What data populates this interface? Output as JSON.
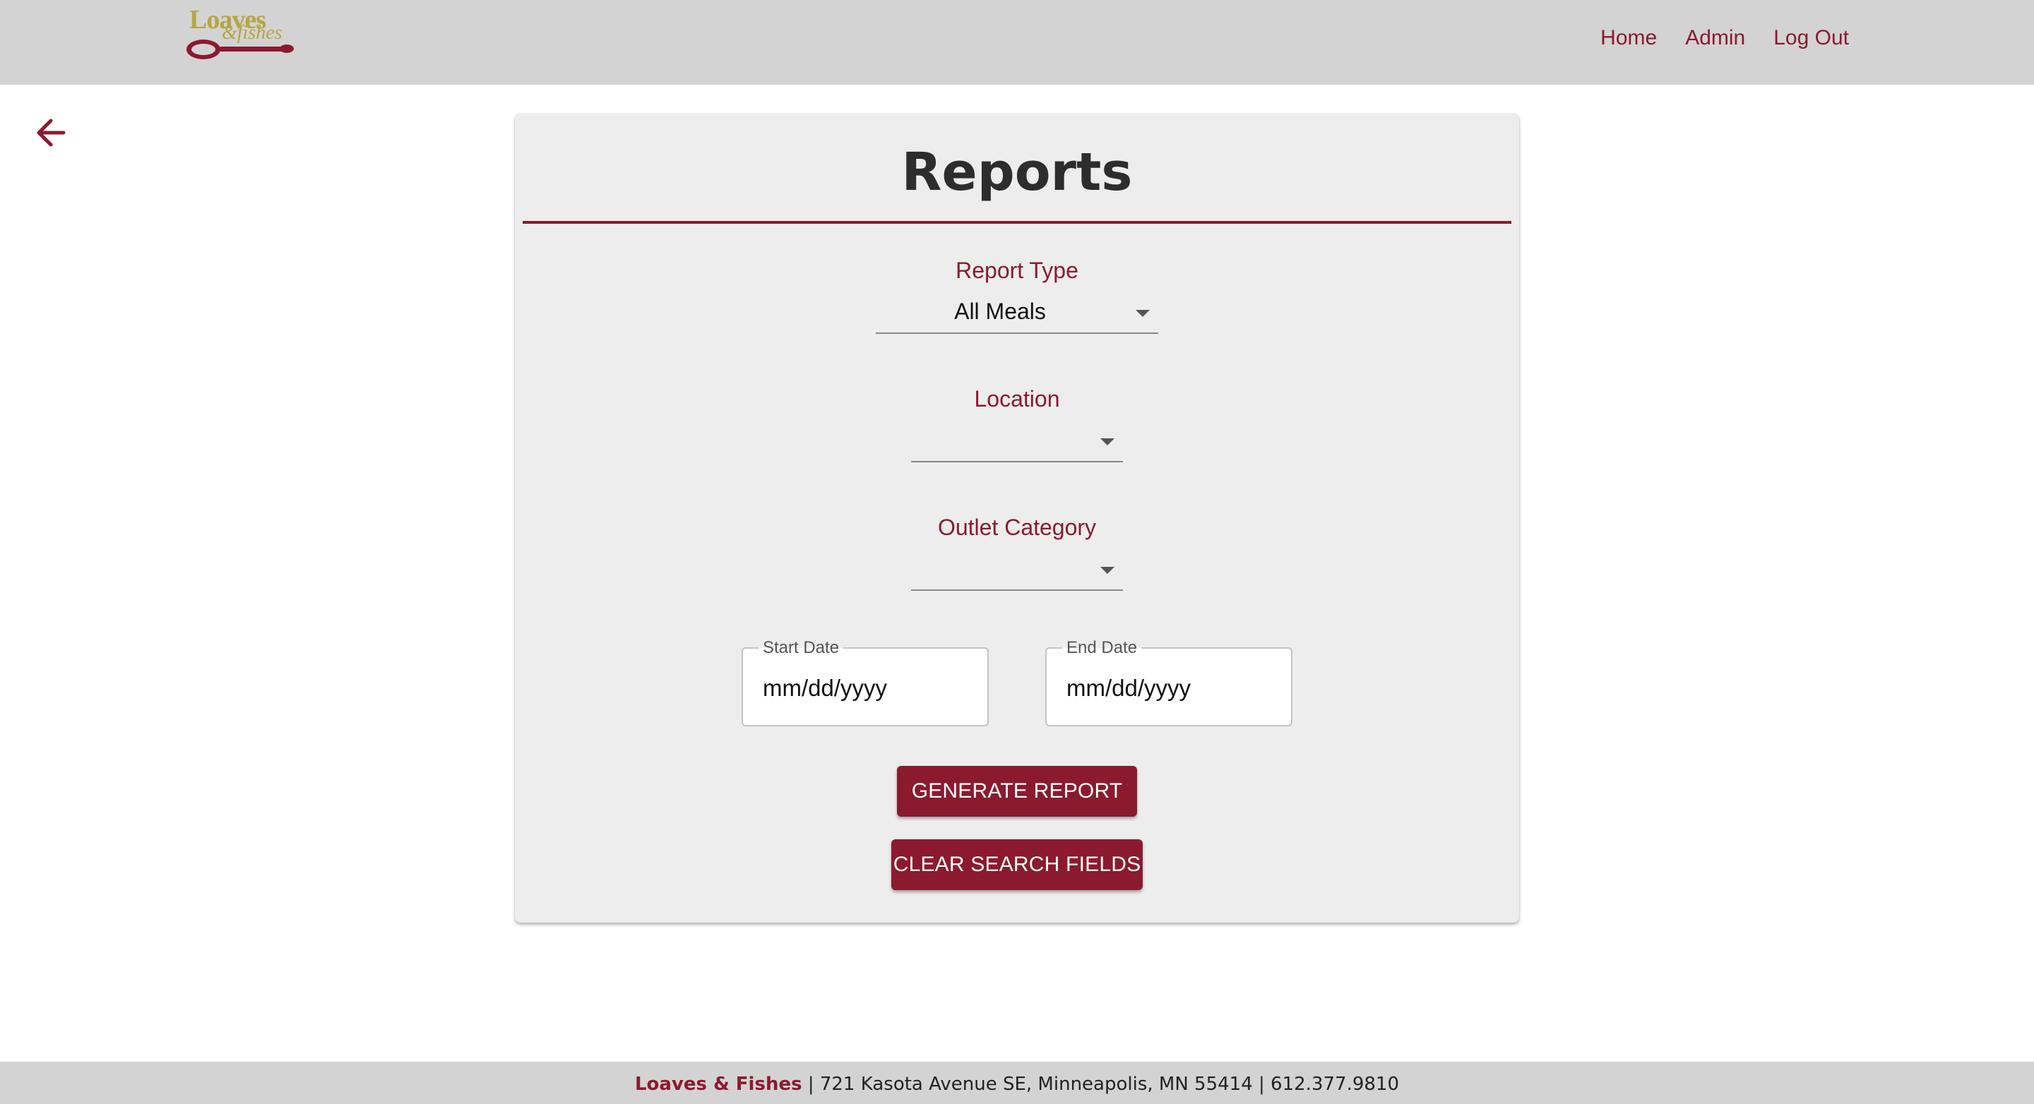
{
  "navbar": {
    "logo_text": "Loaves",
    "logo_subtext": "&fishes",
    "links": [
      "Home",
      "Admin",
      "Log Out"
    ]
  },
  "page": {
    "title": "Reports"
  },
  "form": {
    "report_type": {
      "label": "Report Type",
      "value": "All Meals"
    },
    "location": {
      "label": "Location",
      "value": ""
    },
    "outlet_category": {
      "label": "Outlet Category",
      "value": ""
    },
    "start_date": {
      "label": "Start Date",
      "placeholder": "mm/dd/yyyy"
    },
    "end_date": {
      "label": "End Date",
      "placeholder": "mm/dd/yyyy"
    },
    "generate_label": "Generate Report",
    "clear_label": "Clear Search Fields"
  },
  "footer": {
    "brand": "Loaves & Fishes",
    "details": " | 721 Kasota Avenue SE, Minneapolis, MN 55414 | 612.377.9810"
  },
  "colors": {
    "accent": "#8b1a2f",
    "navbar_bg": "#d3d3d3",
    "card_bg": "#ededed",
    "logo_gold": "#b5a642"
  },
  "icons": {
    "back": "arrow-left-icon",
    "caret": "caret-down-icon",
    "logo": "spoon-icon"
  }
}
